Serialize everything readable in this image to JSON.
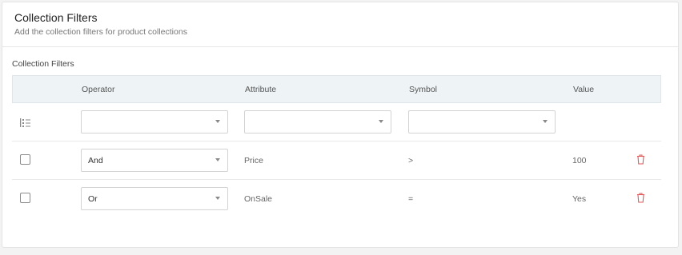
{
  "header": {
    "title": "Collection Filters",
    "subtitle": "Add the collection filters for product collections"
  },
  "section_label": "Collection Filters",
  "table": {
    "columns": [
      "Operator",
      "Attribute",
      "Symbol",
      "Value"
    ],
    "new_row": {
      "operator": "",
      "attribute": "",
      "symbol": ""
    },
    "rows": [
      {
        "operator": "And",
        "attribute": "Price",
        "symbol": ">",
        "value": "100"
      },
      {
        "operator": "Or",
        "attribute": "OnSale",
        "symbol": "=",
        "value": "Yes"
      }
    ]
  },
  "colors": {
    "header_bg": "#eef3f6",
    "delete_icon": "#e05a5a"
  },
  "icons": {
    "list": "list-icon",
    "delete": "trash-icon",
    "dropdown": "chevron-down-icon"
  }
}
